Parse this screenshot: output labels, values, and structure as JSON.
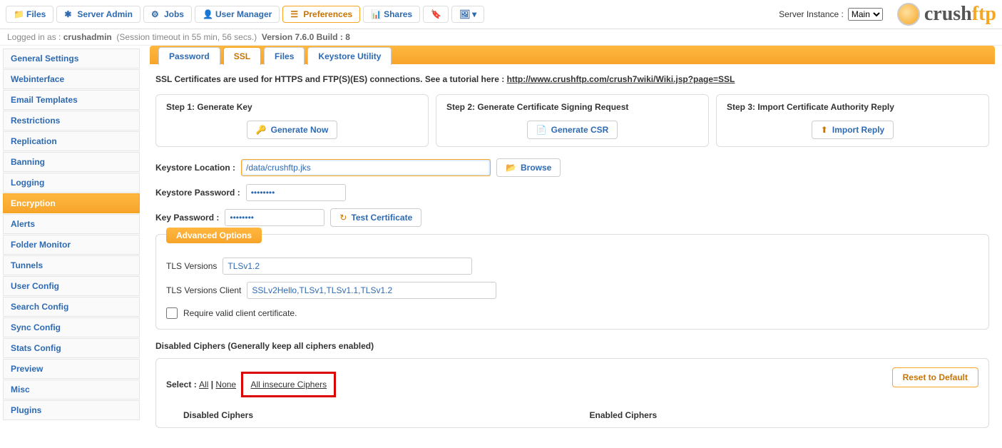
{
  "top": {
    "tabs": [
      "Files",
      "Server Admin",
      "Jobs",
      "User Manager",
      "Preferences",
      "Shares"
    ],
    "active_tab_index": 4,
    "server_instance_label": "Server Instance :",
    "server_instance_value": "Main",
    "logo_left": "crush",
    "logo_right": "ftp"
  },
  "status": {
    "logged_prefix": "Logged in as : ",
    "user": "crushadmin",
    "session": "(Session timeout in 55 min, 56 secs.)",
    "version": "Version 7.6.0 Build : 8"
  },
  "sidebar": {
    "items": [
      "General Settings",
      "Webinterface",
      "Email Templates",
      "Restrictions",
      "Replication",
      "Banning",
      "Logging",
      "Encryption",
      "Alerts",
      "Folder Monitor",
      "Tunnels",
      "User Config",
      "Search Config",
      "Sync Config",
      "Stats Config",
      "Preview",
      "Misc",
      "Plugins"
    ],
    "active_index": 7
  },
  "subtabs": {
    "items": [
      "Password",
      "SSL",
      "Files",
      "Keystore Utility"
    ],
    "active_index": 1
  },
  "intro": {
    "text": "SSL Certificates are used for HTTPS and FTP(S)(ES) connections. See a tutorial here : ",
    "link": "http://www.crushftp.com/crush7wiki/Wiki.jsp?page=SSL"
  },
  "steps": {
    "s1": {
      "title": "Step 1: Generate Key",
      "btn": "Generate Now"
    },
    "s2": {
      "title": "Step 2: Generate Certificate Signing Request",
      "btn": "Generate CSR"
    },
    "s3": {
      "title": "Step 3: Import Certificate Authority Reply",
      "btn": "Import Reply"
    }
  },
  "fields": {
    "keystore_loc_label": "Keystore Location :",
    "keystore_loc_value": "/data/crushftp.jks",
    "browse": "Browse",
    "keystore_pw_label": "Keystore Password :",
    "keystore_pw_value": "••••••••",
    "key_pw_label": "Key Password :",
    "key_pw_value": "••••••••",
    "test_cert": "Test Certificate"
  },
  "adv": {
    "legend": "Advanced Options",
    "tls_label": "TLS Versions",
    "tls_value": "TLSv1.2",
    "tlsc_label": "TLS Versions Client",
    "tlsc_value": "SSLv2Hello,TLSv1,TLSv1.1,TLSv1.2",
    "require_cert": "Require valid client certificate."
  },
  "ciphers": {
    "title": "Disabled Ciphers (Generally keep all ciphers enabled)",
    "select_label": "Select : ",
    "all": "All",
    "none": "None",
    "insecure": "All insecure Ciphers",
    "reset": "Reset to Default",
    "col_disabled": "Disabled Ciphers",
    "col_enabled": "Enabled Ciphers"
  }
}
